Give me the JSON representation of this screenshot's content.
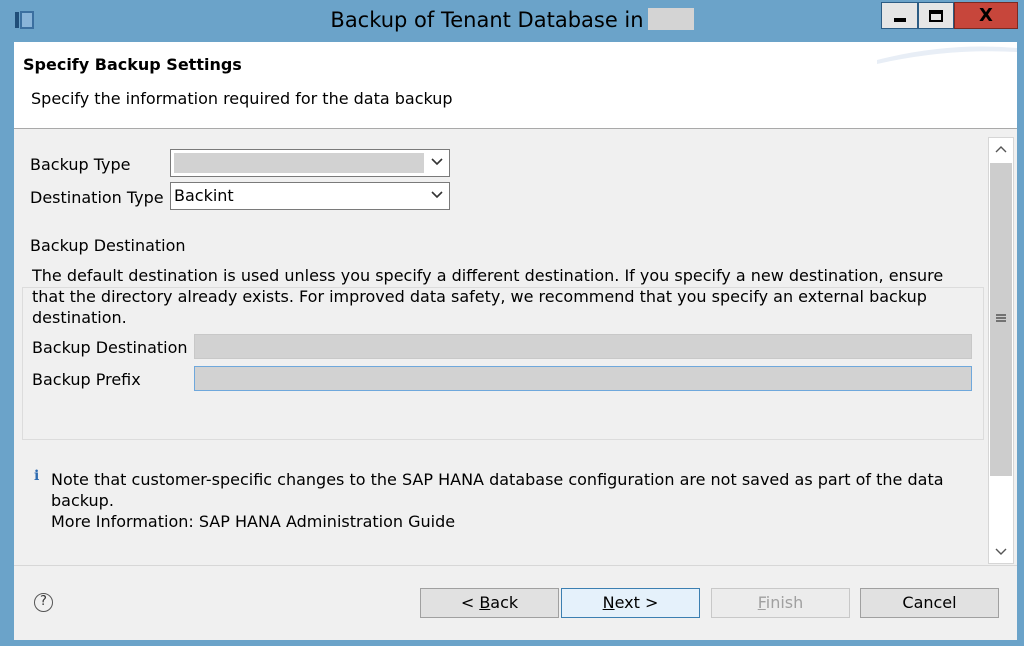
{
  "window": {
    "title": "Backup of Tenant Database in",
    "controls": {
      "close_glyph": "X"
    }
  },
  "banner": {
    "title": "Specify Backup Settings",
    "description": "Specify the information required for the data backup"
  },
  "form": {
    "backup_type_label": "Backup Type",
    "destination_type_label": "Destination Type",
    "destination_type_value": "Backint"
  },
  "destination_group": {
    "title": "Backup Destination",
    "description": "The default destination is used unless you specify a different destination. If you specify a new destination, ensure that the directory already exists. For improved data safety, we recommend that you specify an external backup destination.",
    "destination_label": "Backup Destination",
    "prefix_label": "Backup Prefix"
  },
  "note": {
    "icon": "i",
    "text": "Note that customer-specific changes to the SAP HANA database configuration are not saved as part of the data backup.",
    "more_info": "More Information: SAP HANA Administration Guide"
  },
  "footer": {
    "help_glyph": "?",
    "back_prefix": "< ",
    "back_mnemonic": "B",
    "back_rest": "ack",
    "next_mnemonic": "N",
    "next_rest": "ext >",
    "finish_mnemonic": "F",
    "finish_rest": "inish",
    "cancel_label": "Cancel"
  },
  "colors": {
    "title_bar": "#6ba3c9",
    "close_button": "#c7463b",
    "dialog_bg": "#f0f0f0",
    "focus_border": "#6fa8dc"
  },
  "icons": [
    "app-icon",
    "minimize-icon",
    "maximize-icon",
    "close-icon",
    "chevron-down-icon",
    "info-icon",
    "help-icon",
    "scroll-up-icon",
    "scroll-down-icon"
  ]
}
